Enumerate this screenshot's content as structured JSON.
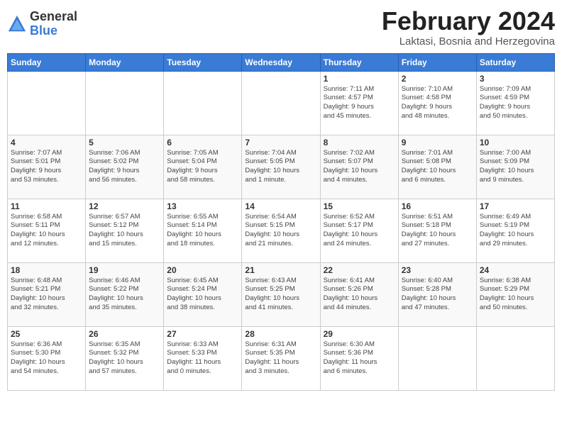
{
  "logo": {
    "general": "General",
    "blue": "Blue"
  },
  "header": {
    "month": "February 2024",
    "location": "Laktasi, Bosnia and Herzegovina"
  },
  "days_of_week": [
    "Sunday",
    "Monday",
    "Tuesday",
    "Wednesday",
    "Thursday",
    "Friday",
    "Saturday"
  ],
  "weeks": [
    [
      {
        "day": "",
        "info": ""
      },
      {
        "day": "",
        "info": ""
      },
      {
        "day": "",
        "info": ""
      },
      {
        "day": "",
        "info": ""
      },
      {
        "day": "1",
        "info": "Sunrise: 7:11 AM\nSunset: 4:57 PM\nDaylight: 9 hours\nand 45 minutes."
      },
      {
        "day": "2",
        "info": "Sunrise: 7:10 AM\nSunset: 4:58 PM\nDaylight: 9 hours\nand 48 minutes."
      },
      {
        "day": "3",
        "info": "Sunrise: 7:09 AM\nSunset: 4:59 PM\nDaylight: 9 hours\nand 50 minutes."
      }
    ],
    [
      {
        "day": "4",
        "info": "Sunrise: 7:07 AM\nSunset: 5:01 PM\nDaylight: 9 hours\nand 53 minutes."
      },
      {
        "day": "5",
        "info": "Sunrise: 7:06 AM\nSunset: 5:02 PM\nDaylight: 9 hours\nand 56 minutes."
      },
      {
        "day": "6",
        "info": "Sunrise: 7:05 AM\nSunset: 5:04 PM\nDaylight: 9 hours\nand 58 minutes."
      },
      {
        "day": "7",
        "info": "Sunrise: 7:04 AM\nSunset: 5:05 PM\nDaylight: 10 hours\nand 1 minute."
      },
      {
        "day": "8",
        "info": "Sunrise: 7:02 AM\nSunset: 5:07 PM\nDaylight: 10 hours\nand 4 minutes."
      },
      {
        "day": "9",
        "info": "Sunrise: 7:01 AM\nSunset: 5:08 PM\nDaylight: 10 hours\nand 6 minutes."
      },
      {
        "day": "10",
        "info": "Sunrise: 7:00 AM\nSunset: 5:09 PM\nDaylight: 10 hours\nand 9 minutes."
      }
    ],
    [
      {
        "day": "11",
        "info": "Sunrise: 6:58 AM\nSunset: 5:11 PM\nDaylight: 10 hours\nand 12 minutes."
      },
      {
        "day": "12",
        "info": "Sunrise: 6:57 AM\nSunset: 5:12 PM\nDaylight: 10 hours\nand 15 minutes."
      },
      {
        "day": "13",
        "info": "Sunrise: 6:55 AM\nSunset: 5:14 PM\nDaylight: 10 hours\nand 18 minutes."
      },
      {
        "day": "14",
        "info": "Sunrise: 6:54 AM\nSunset: 5:15 PM\nDaylight: 10 hours\nand 21 minutes."
      },
      {
        "day": "15",
        "info": "Sunrise: 6:52 AM\nSunset: 5:17 PM\nDaylight: 10 hours\nand 24 minutes."
      },
      {
        "day": "16",
        "info": "Sunrise: 6:51 AM\nSunset: 5:18 PM\nDaylight: 10 hours\nand 27 minutes."
      },
      {
        "day": "17",
        "info": "Sunrise: 6:49 AM\nSunset: 5:19 PM\nDaylight: 10 hours\nand 29 minutes."
      }
    ],
    [
      {
        "day": "18",
        "info": "Sunrise: 6:48 AM\nSunset: 5:21 PM\nDaylight: 10 hours\nand 32 minutes."
      },
      {
        "day": "19",
        "info": "Sunrise: 6:46 AM\nSunset: 5:22 PM\nDaylight: 10 hours\nand 35 minutes."
      },
      {
        "day": "20",
        "info": "Sunrise: 6:45 AM\nSunset: 5:24 PM\nDaylight: 10 hours\nand 38 minutes."
      },
      {
        "day": "21",
        "info": "Sunrise: 6:43 AM\nSunset: 5:25 PM\nDaylight: 10 hours\nand 41 minutes."
      },
      {
        "day": "22",
        "info": "Sunrise: 6:41 AM\nSunset: 5:26 PM\nDaylight: 10 hours\nand 44 minutes."
      },
      {
        "day": "23",
        "info": "Sunrise: 6:40 AM\nSunset: 5:28 PM\nDaylight: 10 hours\nand 47 minutes."
      },
      {
        "day": "24",
        "info": "Sunrise: 6:38 AM\nSunset: 5:29 PM\nDaylight: 10 hours\nand 50 minutes."
      }
    ],
    [
      {
        "day": "25",
        "info": "Sunrise: 6:36 AM\nSunset: 5:30 PM\nDaylight: 10 hours\nand 54 minutes."
      },
      {
        "day": "26",
        "info": "Sunrise: 6:35 AM\nSunset: 5:32 PM\nDaylight: 10 hours\nand 57 minutes."
      },
      {
        "day": "27",
        "info": "Sunrise: 6:33 AM\nSunset: 5:33 PM\nDaylight: 11 hours\nand 0 minutes."
      },
      {
        "day": "28",
        "info": "Sunrise: 6:31 AM\nSunset: 5:35 PM\nDaylight: 11 hours\nand 3 minutes."
      },
      {
        "day": "29",
        "info": "Sunrise: 6:30 AM\nSunset: 5:36 PM\nDaylight: 11 hours\nand 6 minutes."
      },
      {
        "day": "",
        "info": ""
      },
      {
        "day": "",
        "info": ""
      }
    ]
  ]
}
